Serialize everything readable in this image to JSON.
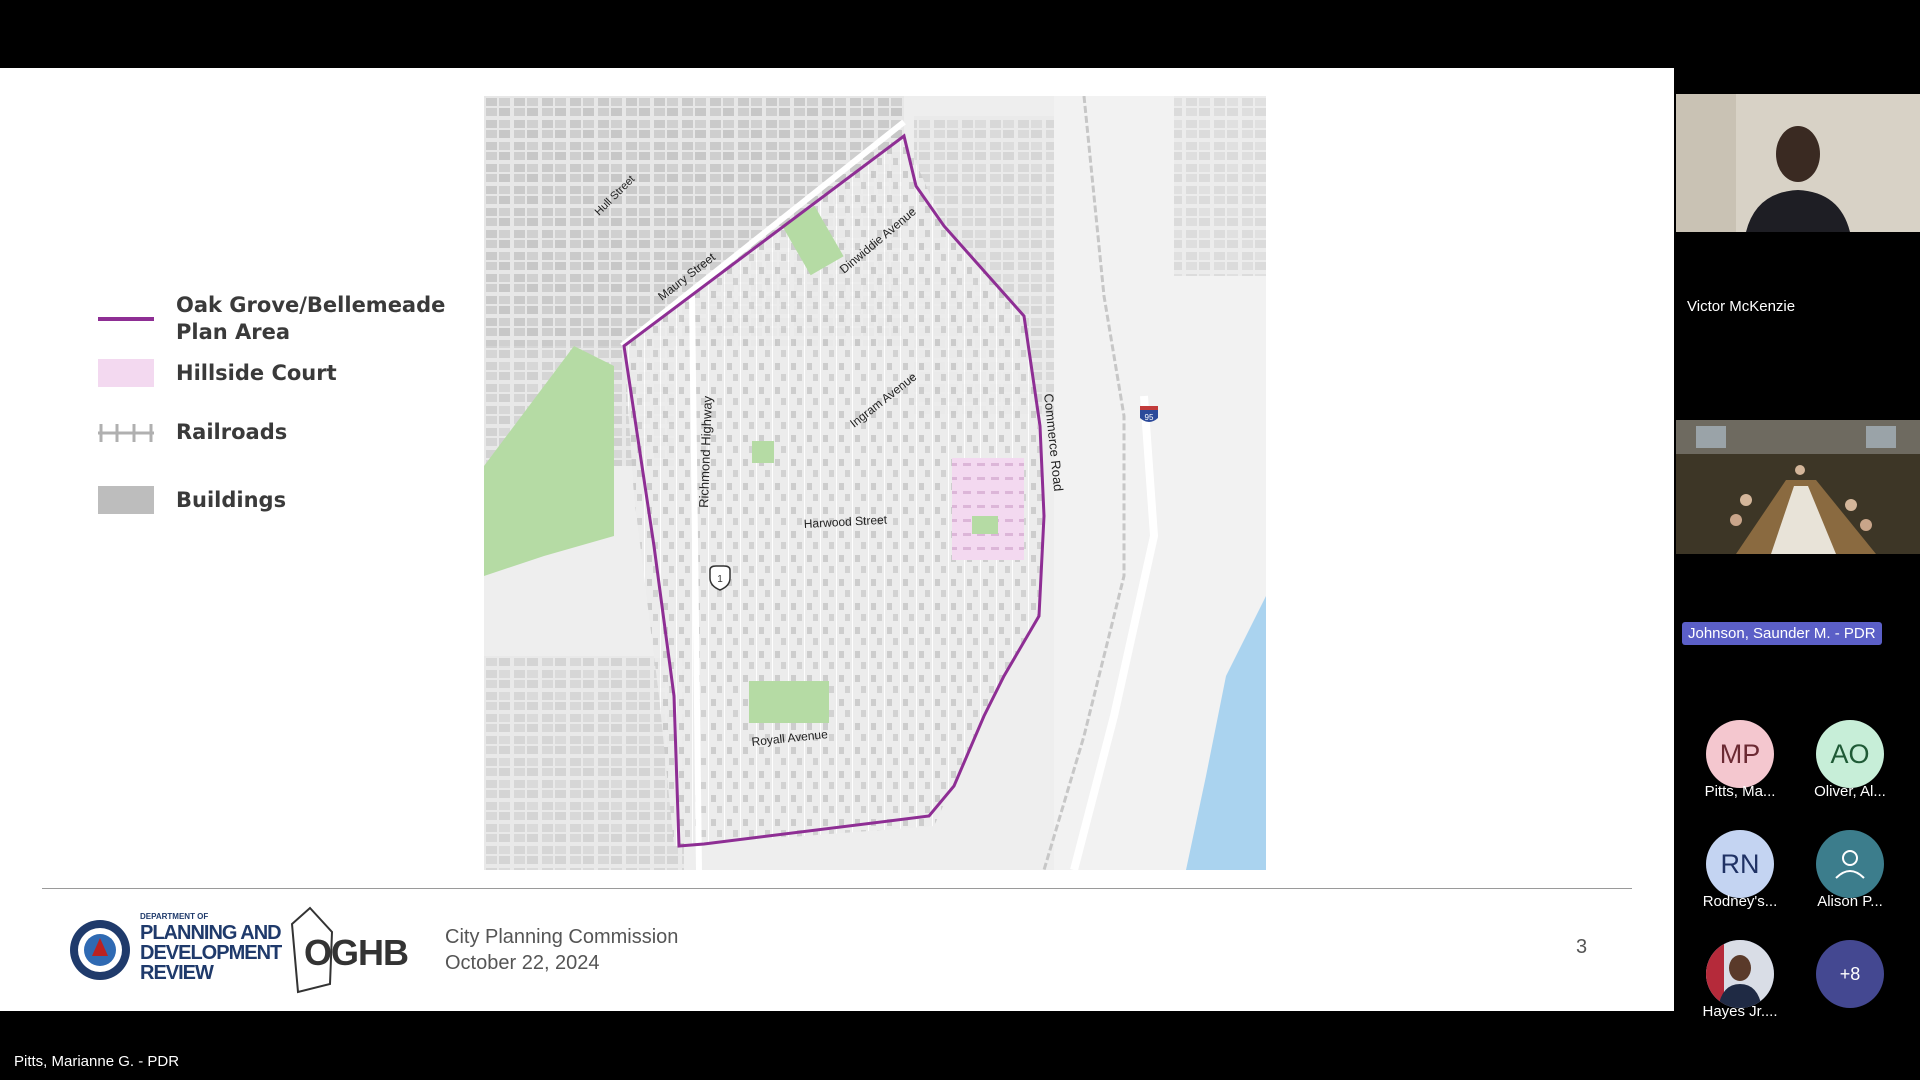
{
  "legend": {
    "plan_area_line1": "Oak Grove/Bellemeade",
    "plan_area_line2": "Plan Area",
    "hillside": "Hillside Court",
    "railroads": "Railroads",
    "buildings": "Buildings"
  },
  "map_labels": {
    "hull": "Hull Street",
    "maury": "Maury Street",
    "dinwiddie": "Dinwiddie Avenue",
    "richmond": "Richmond Highway",
    "ingram": "Ingram Avenue",
    "commerce": "Commerce Road",
    "harwood": "Harwood Street",
    "royall": "Royall Avenue",
    "us1": "1",
    "i95": "95"
  },
  "footer": {
    "dept_small": "DEPARTMENT OF",
    "dept_line1": "PLANNING AND",
    "dept_line2": "DEVELOPMENT",
    "dept_line3": "REVIEW",
    "logo2": "OGHB",
    "line1": "City Planning Commission",
    "line2": "October 22, 2024",
    "page": "3"
  },
  "participants": {
    "speaker1": "Victor McKenzie",
    "speaker2": "Johnson, Saunder M. - PDR",
    "mp_initials": "MP",
    "mp_name": "Pitts, Ma...",
    "ao_initials": "AO",
    "ao_name": "Oliver, Al...",
    "rn_initials": "RN",
    "rn_name": "Rodney's...",
    "ap_name": "Alison P...",
    "hayes_name": "Hayes Jr....",
    "more": "+8"
  },
  "presenter": "Pitts, Marianne G. - PDR",
  "colors": {
    "plan_outline": "#8e2e94",
    "hillside": "#f3d9f0",
    "park": "#b5dba4",
    "building": "#bdbdbd"
  }
}
